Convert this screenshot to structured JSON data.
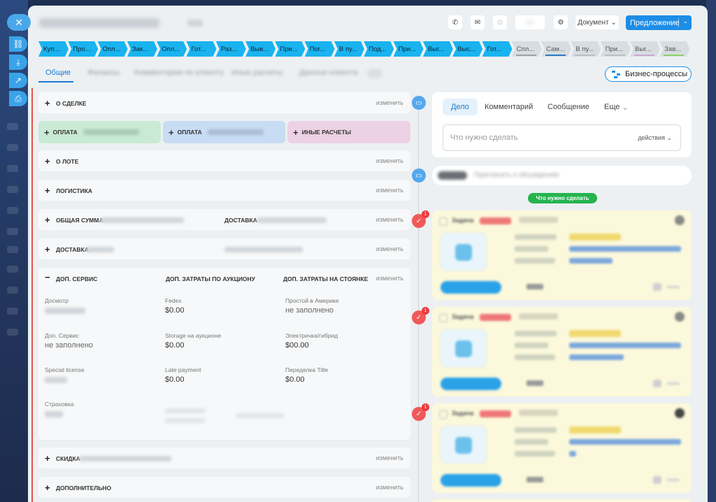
{
  "sidebar": {
    "close_icon": "✕"
  },
  "header": {
    "doc_label": "Документ",
    "primary_label": "Предложение"
  },
  "stages": [
    {
      "label": "Куп...",
      "state": "on"
    },
    {
      "label": "Про...",
      "state": "on"
    },
    {
      "label": "Опл...",
      "state": "on"
    },
    {
      "label": "Зак...",
      "state": "on"
    },
    {
      "label": "Опл...",
      "state": "on"
    },
    {
      "label": "Гот...",
      "state": "on"
    },
    {
      "label": "Раз...",
      "state": "on"
    },
    {
      "label": "Выв...",
      "state": "on"
    },
    {
      "label": "При...",
      "state": "on"
    },
    {
      "label": "Пог...",
      "state": "on"
    },
    {
      "label": "В пу...",
      "state": "on"
    },
    {
      "label": "Под...",
      "state": "on"
    },
    {
      "label": "При...",
      "state": "on"
    },
    {
      "label": "Выг...",
      "state": "on"
    },
    {
      "label": "Выс...",
      "state": "on"
    },
    {
      "label": "Гот...",
      "state": "on"
    },
    {
      "label": "Спл...",
      "state": "off",
      "bar": "#9aa3ab"
    },
    {
      "label": "Сам...",
      "state": "off",
      "bar": "#2c78c4"
    },
    {
      "label": "В пу...",
      "state": "off",
      "bar": "#b9c0c6"
    },
    {
      "label": "При...",
      "state": "off",
      "bar": "#b9c0c6"
    },
    {
      "label": "Выг...",
      "state": "off",
      "bar": "#c9a8d6"
    },
    {
      "label": "Зав...",
      "state": "off",
      "bar": "#8fd16a"
    }
  ],
  "tabs": {
    "active": "Общие"
  },
  "bp_button": "Бизнес-процессы",
  "sections": {
    "about_deal": "О СДЕЛКЕ",
    "payment1": "ОПЛАТА",
    "payment2": "ОПЛАТА",
    "other_calc": "ИНЫЕ РАСЧЕТЫ",
    "lot": "О ЛОТЕ",
    "logistics": "ЛОГИСТИКА",
    "total_sum": "ОБЩАЯ СУММА",
    "delivery_right": "ДОСТАВКА",
    "delivery": "ДОСТАВКА",
    "extra_service": "ДОП. СЕРВИС",
    "auction_costs": "ДОП. ЗАТРАТЫ ПО АУКЦИОНУ",
    "parking_costs": "ДОП. ЗАТРАТЫ НА СТОЯНКЕ",
    "discount": "СКИДКА",
    "additional": "ДОПОЛНИТЕЛЬНО",
    "edit": "изменить"
  },
  "fields": {
    "inspection": {
      "label": "Досмотр"
    },
    "fedex": {
      "label": "Fedex",
      "value": "$0.00"
    },
    "america_idle": {
      "label": "Простой в Америке",
      "value": "не заполнено"
    },
    "extra_service": {
      "label": "Доп. Сервис",
      "value": "не заполнено"
    },
    "storage": {
      "label": "Storage на аукционе",
      "value": "$0.00"
    },
    "electric": {
      "label": "Электричка/гибрид",
      "value": "$00.00"
    },
    "special_license": {
      "label": "Special license"
    },
    "late_payment": {
      "label": "Late payment",
      "value": "$0.00"
    },
    "title_rework": {
      "label": "Переделка Title",
      "value": "$0.00"
    },
    "insurance": {
      "label": "Страховка"
    }
  },
  "activity": {
    "tabs": [
      "Дело",
      "Комментарий",
      "Сообщение",
      "Еще"
    ],
    "placeholder": "Что нужно сделать",
    "actions": "действия"
  },
  "todo_pill": "Что нужно сделать",
  "tasks": [
    {
      "badge": "1"
    },
    {
      "badge": "1"
    },
    {
      "badge": "1"
    }
  ],
  "colors": {
    "accent": "#1e8de6",
    "stage_active": "#19b3ef",
    "badge": "#ef3b3b",
    "todo_green": "#25b44f"
  }
}
